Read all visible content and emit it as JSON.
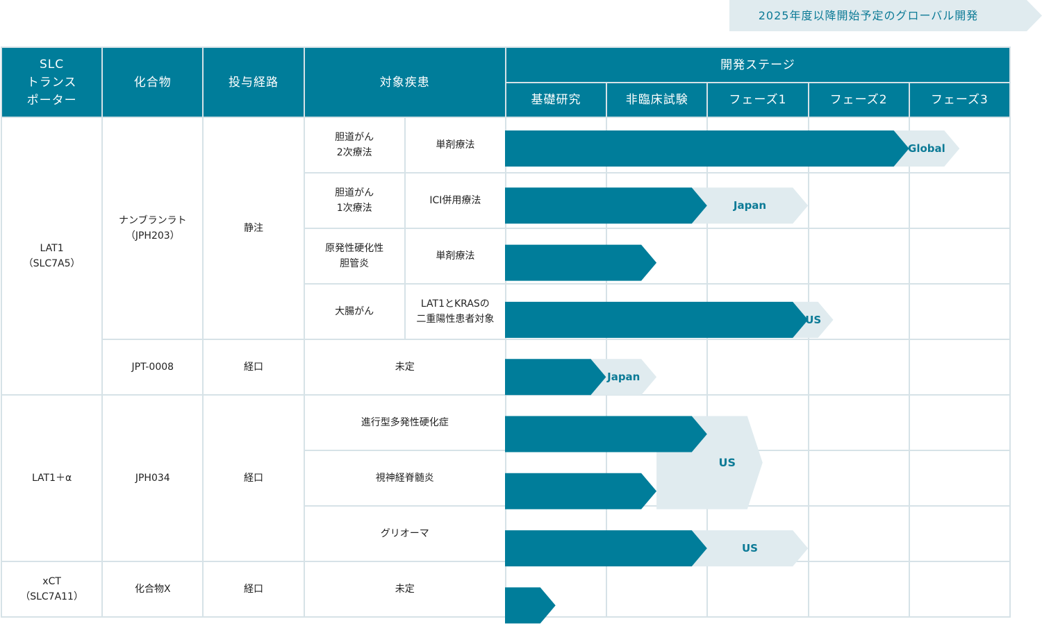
{
  "legend": {
    "label": "2025年度以降開始予定のグローバル開発"
  },
  "headers": {
    "transporter": [
      "SLC",
      "トランス",
      "ポーター"
    ],
    "compound": "化合物",
    "route": "投与経路",
    "disease": "対象疾患",
    "stage_group": "開発ステージ",
    "stages": [
      "基礎研究",
      "非臨床試験",
      "フェーズ1",
      "フェーズ2",
      "フェーズ3"
    ]
  },
  "transporters": [
    {
      "lines": [
        "LAT1",
        "（SLC7A5）"
      ]
    },
    {
      "lines": [
        "LAT1＋α"
      ]
    },
    {
      "lines": [
        "xCT",
        "（SLC7A11）"
      ]
    }
  ],
  "compounds": [
    {
      "lines": [
        "ナンブランラト",
        "（JPH203）"
      ],
      "route": "静注"
    },
    {
      "lines": [
        "JPT-0008"
      ],
      "route": "経口"
    },
    {
      "lines": [
        "JPH034"
      ],
      "route": "経口"
    },
    {
      "lines": [
        "化合物Ⅹ"
      ],
      "route": "経口"
    }
  ],
  "rows": [
    {
      "disease": [
        "胆道がん",
        "2次療法"
      ],
      "therapy": [
        "単剤療法"
      ],
      "progress": 4.0,
      "global": {
        "to": 4.5,
        "label": "Global"
      }
    },
    {
      "disease": [
        "胆道がん",
        "1次療法"
      ],
      "therapy": [
        "ICI併用療法"
      ],
      "progress": 2.0,
      "global": {
        "to": 3.0,
        "label": "Japan"
      }
    },
    {
      "disease": [
        "原発性硬化性",
        "胆管炎"
      ],
      "therapy": [
        "単剤療法"
      ],
      "progress": 1.5
    },
    {
      "disease": [
        "大腸がん"
      ],
      "therapy": [
        "LAT1とKRASの",
        "二重陽性患者対象"
      ],
      "progress": 3.0,
      "global": {
        "to": 3.25,
        "label": "US"
      }
    },
    {
      "disease": [
        "未定"
      ],
      "progress": 1.0,
      "global": {
        "to": 1.5,
        "label": "Japan"
      }
    },
    {
      "disease": [
        "進行型多発性硬化症"
      ],
      "progress": 2.0
    },
    {
      "disease": [
        "視神経脊髄炎"
      ],
      "progress": 1.5
    },
    {
      "disease": [
        "グリオーマ"
      ],
      "progress": 2.0,
      "global": {
        "to": 3.0,
        "label": "US"
      }
    },
    {
      "disease": [
        "未定"
      ],
      "progress": 0.5
    }
  ],
  "shared_global": {
    "label": "US"
  },
  "colors": {
    "header": "#007d9a",
    "bar": "#007d9a",
    "global": "#e0ebef",
    "global_text": "#0b7a96",
    "grid": "#d6e2e7"
  }
}
